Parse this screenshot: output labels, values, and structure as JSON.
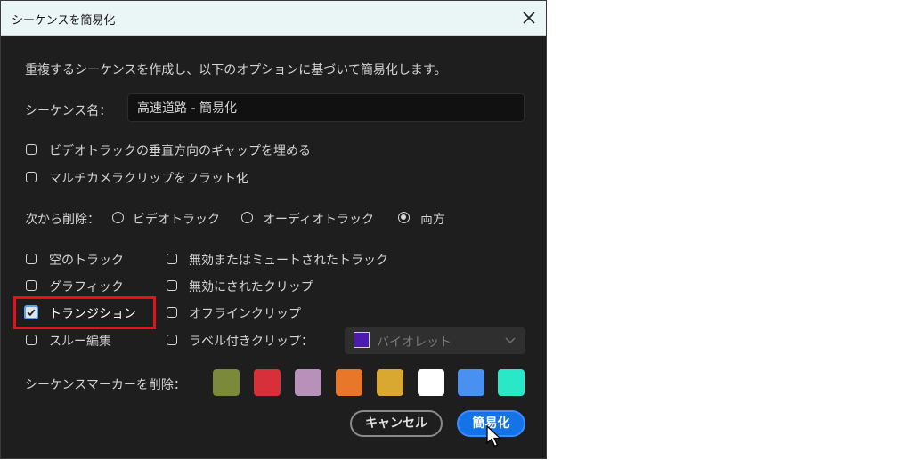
{
  "dialog": {
    "title": "シーケンスを簡易化",
    "description": "重複するシーケンスを作成し、以下のオプションに基づいて簡易化します。",
    "name_label": "シーケンス名：",
    "name_value": "高速道路 - 簡易化",
    "options": [
      {
        "label": "ビデオトラックの垂直方向のギャップを埋める",
        "checked": false
      },
      {
        "label": "マルチカメラクリップをフラット化",
        "checked": false
      }
    ],
    "remove_from": {
      "label": "次から削除：",
      "choices": [
        {
          "label": "ビデオトラック",
          "selected": false
        },
        {
          "label": "オーディオトラック",
          "selected": false
        },
        {
          "label": "両方",
          "selected": true
        }
      ]
    },
    "left_checks": [
      {
        "label": "空のトラック",
        "checked": false
      },
      {
        "label": "グラフィック",
        "checked": false
      },
      {
        "label": "トランジション",
        "checked": true
      },
      {
        "label": "スルー編集",
        "checked": false
      }
    ],
    "right_checks": [
      {
        "label": "無効またはミュートされたトラック",
        "checked": false
      },
      {
        "label": "無効にされたクリップ",
        "checked": false
      },
      {
        "label": "オフラインクリップ",
        "checked": false
      },
      {
        "label": "ラベル付きクリップ：",
        "checked": false
      }
    ],
    "label_select": {
      "value": "バイオレット",
      "color": "#4b1ab0"
    },
    "markers": {
      "label": "シーケンスマーカーを削除：",
      "colors": [
        "#7a8a3a",
        "#d8303a",
        "#b891b8",
        "#e8772a",
        "#d8a830",
        "#ffffff",
        "#4a90f0",
        "#28e8c8"
      ]
    },
    "buttons": {
      "cancel": "キャンセル",
      "ok": "簡易化"
    }
  }
}
